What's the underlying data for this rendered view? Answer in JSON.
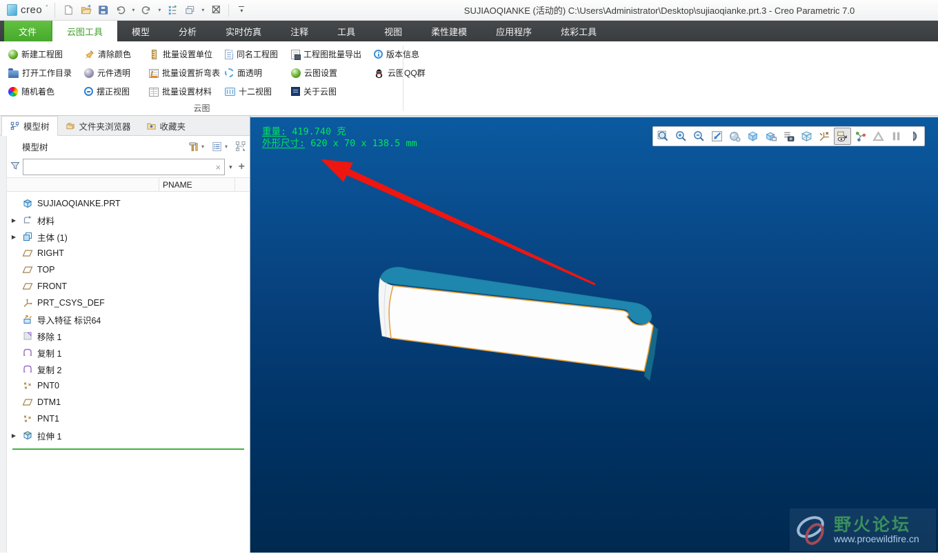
{
  "window": {
    "app_logo": "creo",
    "title": "SUJIAOQIANKE (活动的) C:\\Users\\Administrator\\Desktop\\sujiaoqianke.prt.3 - Creo Parametric 7.0"
  },
  "quick_access_icons": [
    "new-file",
    "open-file",
    "save",
    "undo",
    "redo",
    "regenerate",
    "windows",
    "close-window",
    "customize"
  ],
  "menu_tabs": [
    {
      "label": "文件"
    },
    {
      "label": "云图工具"
    },
    {
      "label": "模型"
    },
    {
      "label": "分析"
    },
    {
      "label": "实时仿真"
    },
    {
      "label": "注释"
    },
    {
      "label": "工具"
    },
    {
      "label": "视图"
    },
    {
      "label": "柔性建模"
    },
    {
      "label": "应用程序"
    },
    {
      "label": "炫彩工具"
    }
  ],
  "ribbon": {
    "group_label": "云图",
    "columns": [
      [
        {
          "label": "新建工程图",
          "icon": "green-sphere"
        },
        {
          "label": "打开工作目录",
          "icon": "blue-folder"
        },
        {
          "label": "随机着色",
          "icon": "color-wheel"
        }
      ],
      [
        {
          "label": "清除颜色",
          "icon": "broom"
        },
        {
          "label": "元件透明",
          "icon": "gray-sphere"
        },
        {
          "label": "摆正视图",
          "icon": "orient-circle"
        }
      ],
      [
        {
          "label": "批量设置单位",
          "icon": "unit-ruler"
        },
        {
          "label": "批量设置折弯表",
          "icon": "bend-table"
        },
        {
          "label": "批量设置材料",
          "icon": "material-table"
        }
      ],
      [
        {
          "label": "同名工程图",
          "icon": "drawing-page"
        },
        {
          "label": "面透明",
          "icon": "dashed-face"
        },
        {
          "label": "十二视图",
          "icon": "twelve-views"
        }
      ],
      [
        {
          "label": "工程图批量导出",
          "icon": "batch-export"
        },
        {
          "label": "云图设置",
          "icon": "green-sphere"
        },
        {
          "label": "关于云图",
          "icon": "about-dark"
        }
      ],
      [
        {
          "label": "版本信息",
          "icon": "info-circle"
        },
        {
          "label": "云图QQ群",
          "icon": "qq-penguin"
        }
      ]
    ]
  },
  "nav_panel": {
    "tabs": [
      {
        "label": "模型树"
      },
      {
        "label": "文件夹浏览器"
      },
      {
        "label": "收藏夹"
      }
    ],
    "tree_title": "模型树",
    "filter_value": "",
    "column_header": "PNAME",
    "items": [
      {
        "label": "SUJIAOQIANKE.PRT",
        "icon": "part",
        "expand": ""
      },
      {
        "label": "材料",
        "icon": "material-node",
        "expand": "▶"
      },
      {
        "label": "主体 (1)",
        "icon": "body",
        "expand": "▶"
      },
      {
        "label": "RIGHT",
        "icon": "datum-plane",
        "expand": ""
      },
      {
        "label": "TOP",
        "icon": "datum-plane",
        "expand": ""
      },
      {
        "label": "FRONT",
        "icon": "datum-plane",
        "expand": ""
      },
      {
        "label": "PRT_CSYS_DEF",
        "icon": "csys",
        "expand": ""
      },
      {
        "label": "导入特征 标识64",
        "icon": "import-feature",
        "expand": ""
      },
      {
        "label": "移除 1",
        "icon": "remove-feature",
        "expand": ""
      },
      {
        "label": "复制 1",
        "icon": "copy-feature",
        "expand": ""
      },
      {
        "label": "复制 2",
        "icon": "copy-feature",
        "expand": ""
      },
      {
        "label": "PNT0",
        "icon": "datum-points",
        "expand": ""
      },
      {
        "label": "DTM1",
        "icon": "datum-plane",
        "expand": ""
      },
      {
        "label": "PNT1",
        "icon": "datum-points",
        "expand": ""
      },
      {
        "label": "拉伸 1",
        "icon": "extrude",
        "expand": "▶"
      }
    ]
  },
  "viewport": {
    "weight_label": "重量:",
    "weight_value": " 419.740 克",
    "dims_label": "外形尺寸:",
    "dims_value": " 620 x 70 x 138.5 mm",
    "toolbar_icons": [
      "zoom-region",
      "zoom-in",
      "zoom-out",
      "refit",
      "shading-style",
      "display-style",
      "saved-orientations",
      "view-manager",
      "perspective",
      "datum-display",
      "annotation-display",
      "spin-center",
      "simulate",
      "pause",
      "clipping"
    ]
  },
  "watermark": {
    "title": "野火论坛",
    "url": "www.proewildfire.cn"
  },
  "colors": {
    "accent_green": "#47a82c",
    "viewport_top": "#0b5aa0",
    "viewport_bottom": "#00294f",
    "info_text": "#00e55a",
    "arrow_red": "#ee1610",
    "insert_line": "#3db53d",
    "model_teal": "#1f86ad",
    "model_edge": "#e8a23c"
  }
}
